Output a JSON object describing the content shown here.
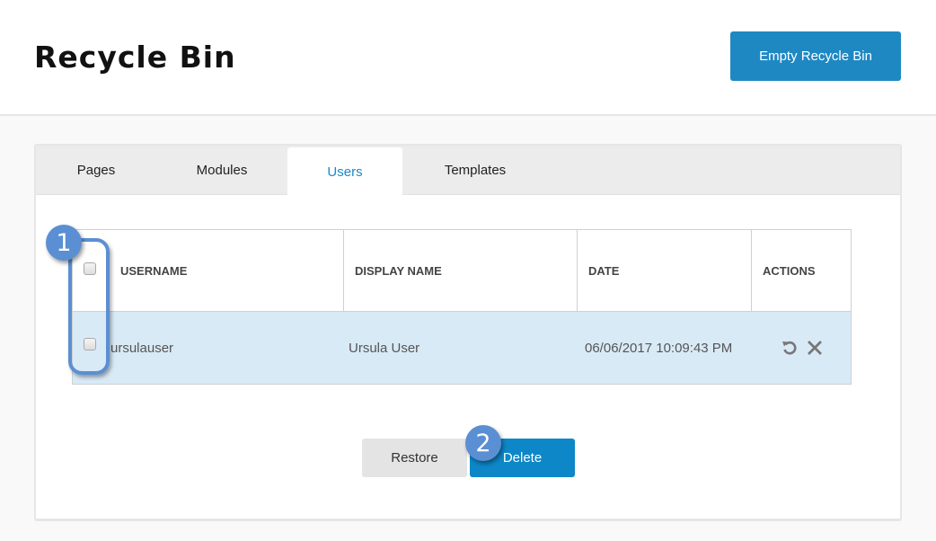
{
  "header": {
    "title": "Recycle Bin",
    "empty_button_label": "Empty Recycle Bin"
  },
  "tabs": [
    {
      "label": "Pages",
      "active": false
    },
    {
      "label": "Modules",
      "active": false
    },
    {
      "label": "Users",
      "active": true
    },
    {
      "label": "Templates",
      "active": false
    }
  ],
  "table": {
    "columns": [
      "USERNAME",
      "DISPLAY NAME",
      "DATE",
      "ACTIONS"
    ],
    "rows": [
      {
        "username": "ursulauser",
        "display_name": "Ursula User",
        "date": "06/06/2017 10:09:43 PM",
        "selected": false,
        "actions": [
          "restore-icon",
          "delete-icon"
        ]
      }
    ]
  },
  "buttons": {
    "restore_label": "Restore",
    "delete_label": "Delete"
  },
  "callouts": [
    {
      "number": "1",
      "target": "checkbox-column"
    },
    {
      "number": "2",
      "target": "delete-button"
    }
  ],
  "colors": {
    "accent": "#1e88c3",
    "row_highlight": "#d9eaf7",
    "callout": "#5b8fd3"
  }
}
